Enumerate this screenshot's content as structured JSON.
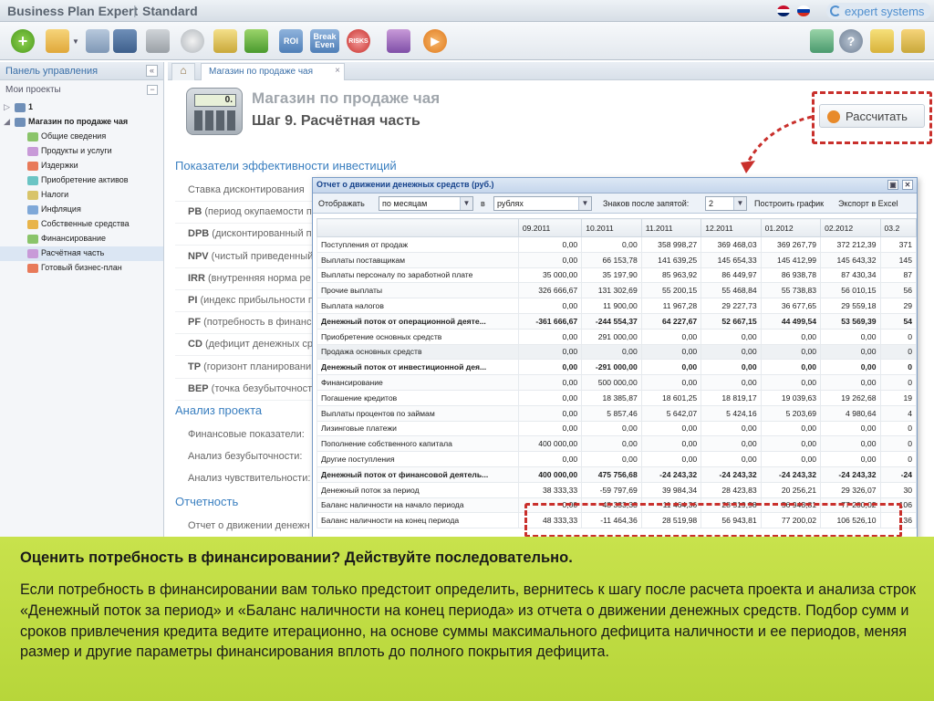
{
  "app": {
    "name": "Business Plan Expert",
    "separator": "|",
    "edition": "Standard",
    "brand": "expert systems"
  },
  "toolbar": {
    "roi_label": "ROI",
    "break_even_label": "Break Even",
    "risks_label": "RISKS"
  },
  "sidebar": {
    "panel_title": "Панель управления",
    "collapse_glyph": "«",
    "projects_title": "Мои проекты",
    "minus_glyph": "−",
    "tree": [
      {
        "label": "1",
        "level": 0,
        "bold": true
      },
      {
        "label": "Магазин по продаже чая",
        "level": 0,
        "bold": true
      },
      {
        "label": "Общие сведения",
        "level": 1
      },
      {
        "label": "Продукты и услуги",
        "level": 1
      },
      {
        "label": "Издержки",
        "level": 1
      },
      {
        "label": "Приобретение активов",
        "level": 1
      },
      {
        "label": "Налоги",
        "level": 1
      },
      {
        "label": "Инфляция",
        "level": 1
      },
      {
        "label": "Собственные средства",
        "level": 1
      },
      {
        "label": "Финансирование",
        "level": 1
      },
      {
        "label": "Расчётная часть",
        "level": 1,
        "selected": true
      },
      {
        "label": "Готовый бизнес-план",
        "level": 1
      }
    ]
  },
  "tabs": {
    "active_tab": "Магазин по продаже чая",
    "close_glyph": "×"
  },
  "page": {
    "calc_display": "0.",
    "project_title": "Магазин по продаже чая",
    "step_title": "Шаг 9. Расчётная часть",
    "calculate_button": "Рассчитать"
  },
  "sections": {
    "efficiency": {
      "title": "Показатели эффективности инвестиций",
      "rows": [
        {
          "abbr": "",
          "text": "Ставка дисконтирования"
        },
        {
          "abbr": "PB",
          "text": " (период окупаемости п"
        },
        {
          "abbr": "DPB",
          "text": " (дисконтированный п"
        },
        {
          "abbr": "NPV",
          "text": " (чистый приведенный"
        },
        {
          "abbr": "IRR",
          "text": " (внутренняя норма ре"
        },
        {
          "abbr": "PI",
          "text": " (индекс прибыльности п"
        },
        {
          "abbr": "PF",
          "text": " (потребность в финанс"
        },
        {
          "abbr": "CD",
          "text": " (дефицит денежных ср"
        },
        {
          "abbr": "TP",
          "text": " (горизонт планировани"
        },
        {
          "abbr": "BEP",
          "text": " (точка безубыточност"
        }
      ]
    },
    "analysis": {
      "title": "Анализ проекта",
      "rows": [
        "Финансовые показатели:",
        "Анализ безубыточности:",
        "Анализ чувствительности:"
      ]
    },
    "reports": {
      "title": "Отчетность",
      "rows": [
        "Отчет о движении денежн"
      ]
    }
  },
  "report": {
    "title": "Отчет о движении денежных средств (руб.)",
    "minimize_glyph": "▣",
    "close_glyph": "✕",
    "show_label": "Отображать",
    "period_value": "по месяцам",
    "in_label": "в",
    "currency_value": "рублях",
    "decimals_label": "Знаков после запятой:",
    "decimals_value": "2",
    "plot_label": "Построить график",
    "export_label": "Экспорт в Excel",
    "columns": [
      "",
      "09.2011",
      "10.2011",
      "11.2011",
      "12.2011",
      "01.2012",
      "02.2012",
      "03.2"
    ],
    "rows": [
      {
        "name": "Поступления от продаж",
        "bold": false,
        "values": [
          "0,00",
          "0,00",
          "358 998,27",
          "369 468,03",
          "369 267,79",
          "372 212,39",
          "371"
        ]
      },
      {
        "name": "Выплаты поставщикам",
        "bold": false,
        "values": [
          "0,00",
          "66 153,78",
          "141 639,25",
          "145 654,33",
          "145 412,99",
          "145 643,32",
          "145"
        ]
      },
      {
        "name": "Выплаты персоналу по заработной плате",
        "bold": false,
        "values": [
          "35 000,00",
          "35 197,90",
          "85 963,92",
          "86 449,97",
          "86 938,78",
          "87 430,34",
          "87"
        ]
      },
      {
        "name": "Прочие выплаты",
        "bold": false,
        "values": [
          "326 666,67",
          "131 302,69",
          "55 200,15",
          "55 468,84",
          "55 738,83",
          "56 010,15",
          "56"
        ]
      },
      {
        "name": "Выплата налогов",
        "bold": false,
        "values": [
          "0,00",
          "11 900,00",
          "11 967,28",
          "29 227,73",
          "36 677,65",
          "29 559,18",
          "29"
        ]
      },
      {
        "name": "Денежный поток от операционной деяте...",
        "bold": true,
        "values": [
          "-361 666,67",
          "-244 554,37",
          "64 227,67",
          "52 667,15",
          "44 499,54",
          "53 569,39",
          "54"
        ]
      },
      {
        "name": "Приобретение основных средств",
        "bold": false,
        "values": [
          "0,00",
          "291 000,00",
          "0,00",
          "0,00",
          "0,00",
          "0,00",
          "0"
        ]
      },
      {
        "name": "Продажа основных средств",
        "bold": false,
        "shade": true,
        "values": [
          "0,00",
          "0,00",
          "0,00",
          "0,00",
          "0,00",
          "0,00",
          "0"
        ]
      },
      {
        "name": "Денежный поток от инвестиционной дея...",
        "bold": true,
        "values": [
          "0,00",
          "-291 000,00",
          "0,00",
          "0,00",
          "0,00",
          "0,00",
          "0"
        ]
      },
      {
        "name": "Финансирование",
        "bold": false,
        "values": [
          "0,00",
          "500 000,00",
          "0,00",
          "0,00",
          "0,00",
          "0,00",
          "0"
        ]
      },
      {
        "name": "Погашение кредитов",
        "bold": false,
        "values": [
          "0,00",
          "18 385,87",
          "18 601,25",
          "18 819,17",
          "19 039,63",
          "19 262,68",
          "19"
        ]
      },
      {
        "name": "Выплаты процентов по займам",
        "bold": false,
        "values": [
          "0,00",
          "5 857,46",
          "5 642,07",
          "5 424,16",
          "5 203,69",
          "4 980,64",
          "4"
        ]
      },
      {
        "name": "Лизинговые платежи",
        "bold": false,
        "values": [
          "0,00",
          "0,00",
          "0,00",
          "0,00",
          "0,00",
          "0,00",
          "0"
        ]
      },
      {
        "name": "Пополнение собственного капитала",
        "bold": false,
        "values": [
          "400 000,00",
          "0,00",
          "0,00",
          "0,00",
          "0,00",
          "0,00",
          "0"
        ]
      },
      {
        "name": "Другие поступления",
        "bold": false,
        "values": [
          "0,00",
          "0,00",
          "0,00",
          "0,00",
          "0,00",
          "0,00",
          "0"
        ]
      },
      {
        "name": "Денежный поток от финансовой деятель...",
        "bold": true,
        "values": [
          "400 000,00",
          "475 756,68",
          "-24 243,32",
          "-24 243,32",
          "-24 243,32",
          "-24 243,32",
          "-24"
        ]
      },
      {
        "name": "Денежный поток за период",
        "bold": false,
        "values": [
          "38 333,33",
          "-59 797,69",
          "39 984,34",
          "28 423,83",
          "20 256,21",
          "29 326,07",
          "30"
        ]
      },
      {
        "name": "Баланс наличности на начало периода",
        "bold": false,
        "values": [
          "0,00",
          "48 333,33",
          "-11 464,36",
          "28 519,98",
          "56 943,81",
          "77 200,02",
          "106"
        ]
      },
      {
        "name": "Баланс наличности на конец периода",
        "bold": false,
        "values": [
          "48 333,33",
          "-11 464,36",
          "28 519,98",
          "56 943,81",
          "77 200,02",
          "106 526,10",
          "136"
        ]
      }
    ]
  },
  "overlay": {
    "title": "Оценить потребность в финансировании? Действуйте последовательно.",
    "body": "Если потребность в финансировании вам только предстоит определить, вернитесь к шагу после расчета проекта и анализа строк «Денежный поток за период» и «Баланс наличности на конец периода» из отчета о движении денежных средств. Подбор сумм и сроков привлечения кредита ведите итерационно, на основе суммы максимального дефицита наличности и ее периодов, меняя размер и другие параметры финансирования вплоть до полного покрытия дефицита."
  },
  "colors": {
    "accent_blue": "#3a7fc0",
    "highlight_red": "#c9302c",
    "overlay_green": "#c8e24c"
  }
}
